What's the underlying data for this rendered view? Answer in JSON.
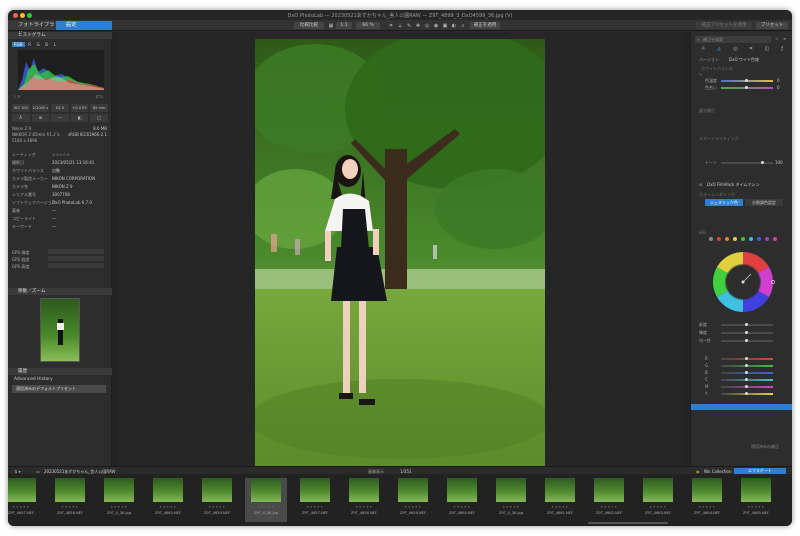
{
  "titlebar": {
    "title": "DxO PhotoLab — 20230521あずかちゃん_舎人公園RAW — Z9T_4899_3_DxO4599_36.jpg (V)"
  },
  "toolbar": {
    "tab_library": "フォトライブラリ",
    "tab_customize": "設定",
    "compare": "比較比較",
    "zoom_fit": "1:1",
    "zoom_pct": "66 %",
    "apply": "補正を適用",
    "preset": "補正プリセットを適用",
    "preset_label": "プリセット"
  },
  "left": {
    "histogram_title": "ヒストグラム",
    "channels": [
      "RGB",
      "R",
      "G",
      "B",
      "L"
    ],
    "info_rows": [
      {
        "label": "ISO 100",
        "value": "1/1000 s"
      },
      {
        "label": "f/2.0",
        "value": "+0.0 EV"
      },
      {
        "label": "85 mm",
        "value": ""
      }
    ],
    "exif": [
      {
        "k": "Nikon Z 9",
        "v": "8.6 MB"
      },
      {
        "k": "NIKKOR Z 85mm f/1.2 S",
        "v": "sRGB IEC61966-2.1"
      },
      {
        "k": "5184 x 4896",
        "v": ""
      }
    ],
    "meta": [
      {
        "k": "レーティング",
        "v": "☆☆☆☆☆"
      },
      {
        "k": "撮影日",
        "v": "2023/05/21 13:16:41"
      },
      {
        "k": "ホワイトバランス",
        "v": "自動"
      },
      {
        "k": "カメラ製造メーカー",
        "v": "NIKON CORPORATION"
      },
      {
        "k": "カメラ名",
        "v": "NIKON Z 9"
      },
      {
        "k": "シリアル番号",
        "v": "3007708"
      },
      {
        "k": "ソフトウェアバージョン",
        "v": "DxO PhotoLab 6.7.0"
      },
      {
        "k": "著者",
        "v": "—"
      },
      {
        "k": "コピーライト",
        "v": "—"
      },
      {
        "k": "キーワード",
        "v": "—"
      }
    ],
    "gps": [
      "GPS 緯度",
      "GPS 経度",
      "GPS 高度"
    ],
    "navigator_title": "移動／ズーム",
    "history_title": "履歴",
    "advanced_history": "Advanced History",
    "history_item": "適用済みのデフォルトプリセット"
  },
  "right": {
    "search_placeholder": "補正を検索",
    "section_wb": "ホワイトバランス",
    "wb_preset": "DxO ワイド色域",
    "wb_mode": "バージョン",
    "temp_label": "色温度",
    "temp_value": "0",
    "tint_label": "色合い",
    "tint_value": "0",
    "exposure_section": "露光補正",
    "smart_lighting": "スマートライティング",
    "tone_label": "トーン",
    "tone_value": "100",
    "filmpack": "DxO FilmPack タイムマシン",
    "color_rendering": "カラーレンダリング",
    "mode_a": "ジェネリック色",
    "mode_b": "分割調色設定",
    "hsl_title": "HSL",
    "saturation": "彩度",
    "luminance": "輝度",
    "uniformity": "均一性",
    "channel_sliders": [
      "R",
      "G",
      "B",
      "C",
      "M",
      "Y"
    ],
    "footer": "適用済みの補正"
  },
  "filmbar": {
    "folder": "20230521あずかちゃん_舎人公園RAW",
    "count_label": "画像表示",
    "count": "1/351",
    "nik": "Nik Collection",
    "export": "エクスポート"
  },
  "thumbs": [
    "Z9T_4657.NEF",
    "Z9T_4658.NEF",
    "Z9T_4_36.jpg",
    "Z9T_4660.NEF",
    "Z9T_4659.NEF",
    "Z9T_4_36.jpg",
    "Z9T_4657.NEF",
    "Z9T_4658.NEF",
    "Z9T_4659.NEF",
    "Z9T_4660.NEF",
    "Z9T_4_36.jpg",
    "Z9T_4661.NEF",
    "Z9T_4662.NEF",
    "Z9T_4663.NEF",
    "Z9T_4664.NEF",
    "Z9T_4665.NEF"
  ],
  "colors": {
    "accent": "#2f7fd1",
    "panel": "#2d2d2d",
    "viewer": "#262626"
  }
}
